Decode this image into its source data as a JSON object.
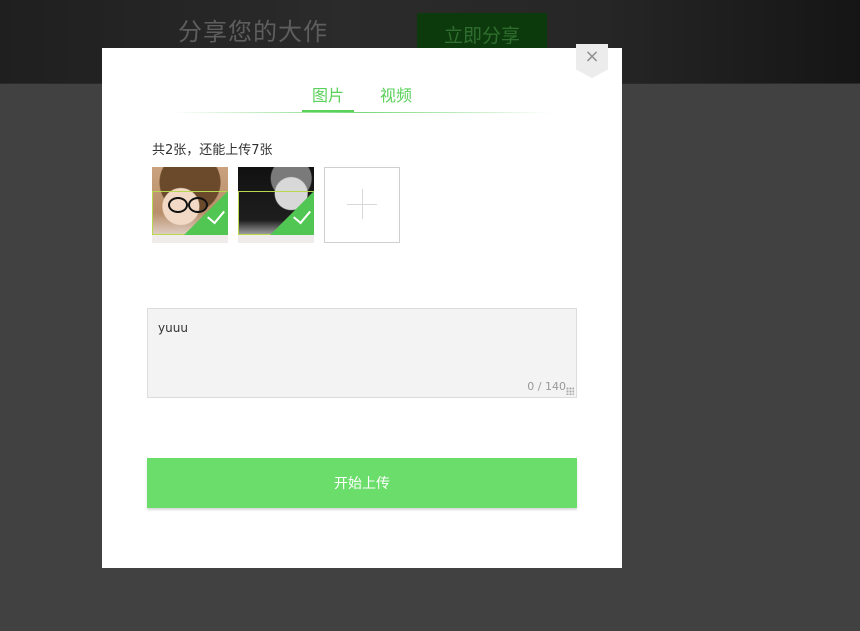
{
  "banner": {
    "title": "分享您的大作",
    "share_button": "立即分享"
  },
  "modal": {
    "close_symbol": "×",
    "tabs": [
      {
        "label": "图片",
        "active": true
      },
      {
        "label": "视频",
        "active": false
      }
    ],
    "count_text": "共2张，还能上传7张",
    "thumbnails": [
      {
        "selected": true
      },
      {
        "selected": true
      }
    ],
    "description": {
      "value": "yuuu",
      "counter": "0 / 140"
    },
    "upload_button": "开始上传"
  },
  "colors": {
    "accent": "#5ad15a",
    "button": "#6bdd6b",
    "overlay": "#414141"
  },
  "icons": [
    "close-icon",
    "check-icon",
    "plus-icon",
    "resize-grip-icon"
  ]
}
